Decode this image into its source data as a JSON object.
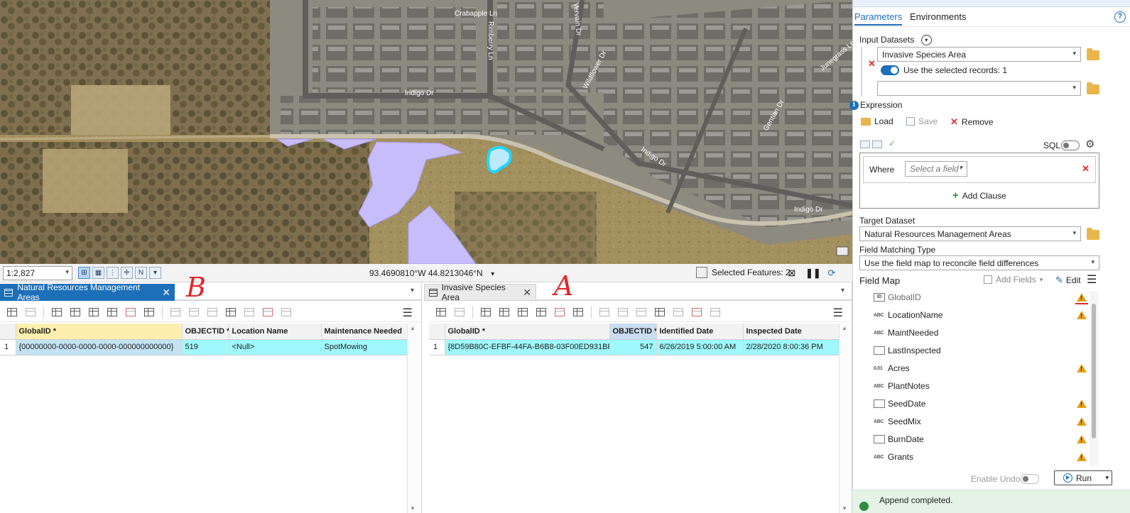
{
  "map_status": {
    "scale": "1:2,827",
    "coordinates": "93.4690810°W 44.8213046°N",
    "selected_features": "Selected Features: 2"
  },
  "map_labels": {
    "crabapple": "Crabapple Ln",
    "rimberry": "Rimberry Ln",
    "vervain": "Vervain Dr",
    "wildflower": "Wildflower Dr",
    "indigo1": "Indigo Dr",
    "indigo2": "Indigo Dr",
    "indigo3": "Indigo Dr",
    "centian": "Gentian Dr",
    "junegrass": "Junegrass Ln"
  },
  "left_table": {
    "tab_title": "Natural Resources Management Areas",
    "annotation": "B",
    "columns": [
      "GlobalID *",
      "OBJECTID *",
      "Location Name",
      "Maintenance Needed"
    ],
    "rows": [
      {
        "num": "1",
        "cells": [
          "{00000000-0000-0000-0000-000000000000}",
          "519",
          "<Null>",
          "SpotMowing"
        ]
      }
    ]
  },
  "right_table": {
    "tab_title": "Invasive Species Area",
    "annotation": "A",
    "columns": [
      "GlobalID *",
      "OBJECTID *",
      "Identified Date",
      "Inspected Date"
    ],
    "rows": [
      {
        "num": "1",
        "cells": [
          "{8D59B80C-EFBF-44FA-B6B8-03F00ED931BF}",
          "547",
          "6/26/2019 5:00:00 AM",
          "2/28/2020 8:00:36 PM"
        ]
      }
    ]
  },
  "gp": {
    "tabs": [
      "Parameters",
      "Environments"
    ],
    "input_datasets_label": "Input Datasets",
    "input_dataset_value": "Invasive Species Area",
    "use_selected": "Use the selected records: 1",
    "empty_input": "",
    "expression_label": "Expression",
    "load": "Load",
    "save": "Save",
    "remove": "Remove",
    "sql": "SQL",
    "where": "Where",
    "select_field": "Select a field",
    "add_clause": "Add Clause",
    "target_dataset_label": "Target Dataset",
    "target_dataset_value": "Natural Resources Management Areas",
    "field_matching_label": "Field Matching Type",
    "field_matching_value": "Use the field map to reconcile field differences",
    "field_map_label": "Field Map",
    "add_fields": "Add Fields",
    "edit": "Edit",
    "fields": [
      {
        "type": "ID",
        "name": "GlobalID",
        "warn": true
      },
      {
        "type": "ABC",
        "name": "LocationName",
        "warn": true
      },
      {
        "type": "ABC",
        "name": "MaintNeeded",
        "warn": false
      },
      {
        "type": "DATE",
        "name": "LastInspected",
        "warn": false
      },
      {
        "type": "0.01",
        "name": "Acres",
        "warn": true
      },
      {
        "type": "ABC",
        "name": "PlantNotes",
        "warn": false
      },
      {
        "type": "DATE",
        "name": "SeedDate",
        "warn": true
      },
      {
        "type": "ABC",
        "name": "SeedMix",
        "warn": true
      },
      {
        "type": "DATE",
        "name": "BurnDate",
        "warn": true
      },
      {
        "type": "ABC",
        "name": "Grants",
        "warn": true
      }
    ],
    "enable_undo": "Enable Undo",
    "run": "Run",
    "completed": "Append completed."
  },
  "colors": {
    "accent": "#1d6fb8",
    "selected_row": "#9ff8fb",
    "polygon_fill": "#c7bdfb",
    "annotation": "#e3262a"
  }
}
